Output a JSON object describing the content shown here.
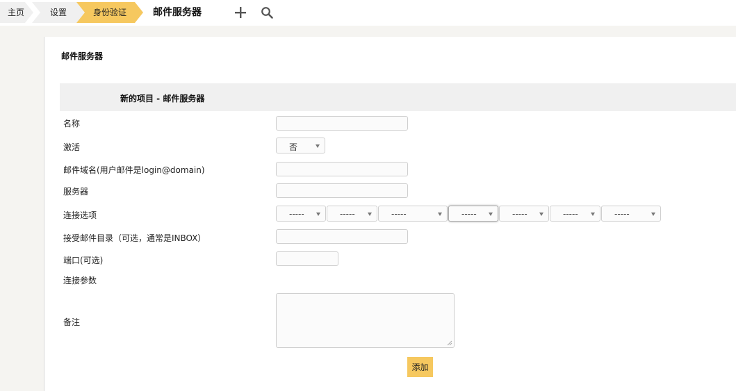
{
  "breadcrumb": {
    "home": "主页",
    "settings": "设置",
    "auth": "身份验证",
    "current": "邮件服务器"
  },
  "icons": {
    "add": "plus-icon",
    "search": "search-icon"
  },
  "panel": {
    "title": "邮件服务器",
    "section_title": "新的项目 - 邮件服务器"
  },
  "form": {
    "name_label": "名称",
    "active_label": "激活",
    "active_value": "否",
    "domain_label": "邮件域名(用户邮件是login@domain)",
    "server_label": "服务器",
    "connection_label": "连接选项",
    "connection_options": [
      "-----",
      "-----",
      "-----",
      "-----",
      "-----",
      "-----",
      "-----"
    ],
    "inbox_label": "接受邮件目录（可选，通常是INBOX）",
    "port_label": "端口(可选)",
    "params_label": "连接参数",
    "notes_label": "备注",
    "submit_label": "添加"
  },
  "colors": {
    "accent": "#f6c85f",
    "crumb_bg": "#f0f0f0",
    "section_bg": "#f0f0f0",
    "page_bg": "#f5f4f1"
  }
}
